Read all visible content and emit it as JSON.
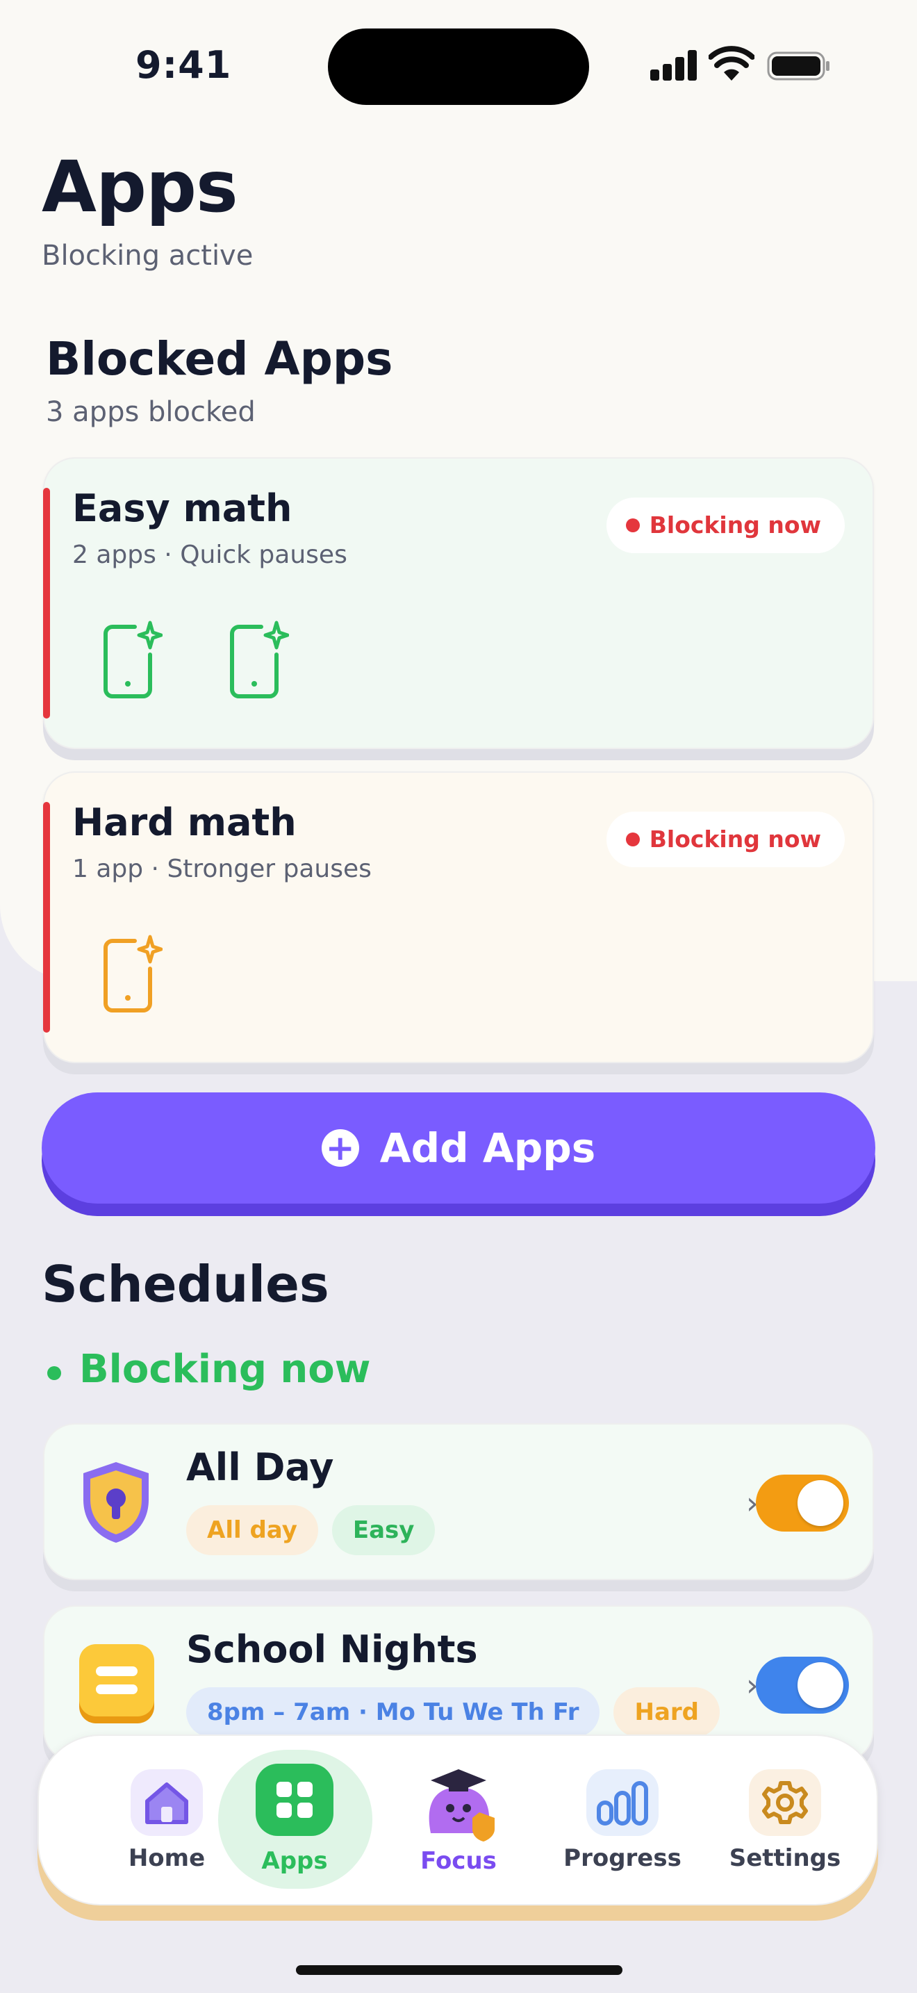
{
  "status": {
    "time": "9:41"
  },
  "header": {
    "title": "Apps",
    "subtitle": "Blocking active"
  },
  "blocked": {
    "title": "Blocked Apps",
    "subtitle": "3 apps blocked",
    "groups": [
      {
        "name": "Easy math",
        "meta": "2 apps · Quick pauses",
        "badge": "Blocking now",
        "app_count": 2,
        "color": "#2bbd5b",
        "bg": "#f1f9f3"
      },
      {
        "name": "Hard math",
        "meta": "1 app · Stronger pauses",
        "badge": "Blocking now",
        "app_count": 1,
        "color": "#f0a024",
        "bg": "#fdf9f1"
      }
    ]
  },
  "add_button": {
    "label": "Add Apps"
  },
  "schedules": {
    "title": "Schedules",
    "now_label": "Blocking now",
    "items": [
      {
        "name": "All Day",
        "chips": [
          "All day",
          "Easy"
        ],
        "enabled": true,
        "toggle_color": "#f39c12",
        "icon": "shield-lock-icon"
      },
      {
        "name": "School Nights",
        "chips": [
          "8pm – 7am · Mo Tu We Th Fr",
          "Hard"
        ],
        "enabled": true,
        "toggle_color": "#3f84ec",
        "icon": "note-icon"
      }
    ]
  },
  "tabbar": {
    "tabs": [
      {
        "label": "Home",
        "icon": "home-icon"
      },
      {
        "label": "Apps",
        "icon": "grid-icon",
        "active": true
      },
      {
        "label": "Focus",
        "icon": "mascot-icon"
      },
      {
        "label": "Progress",
        "icon": "bars-icon"
      },
      {
        "label": "Settings",
        "icon": "gear-icon"
      }
    ]
  },
  "colors": {
    "accent": "#7a5cff",
    "danger": "#e5363d",
    "success": "#2bbd5b"
  }
}
